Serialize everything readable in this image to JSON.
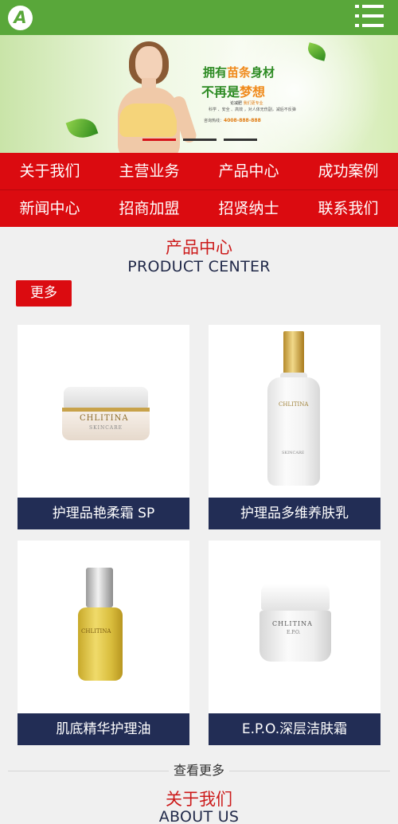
{
  "header": {
    "logo_letter": "A"
  },
  "icons": {
    "logo": "logo-icon",
    "menu": "hamburger-menu-icon"
  },
  "banner": {
    "headline_1_pre": "拥有",
    "headline_1_hl": "苗条",
    "headline_1_post": "身材",
    "headline_2_pre": "不再是",
    "headline_2_hl": "梦想",
    "brand_pre": "论减肥 ",
    "brand_hl": "我们更专业",
    "features": "科学 、安全 、高效 ，对人体无伤副，减后不反弹",
    "hotline_label": "咨询热线：",
    "hotline_number": "4008-888-888",
    "slides": [
      true,
      false,
      false
    ]
  },
  "nav": {
    "items": [
      "关于我们",
      "主营业务",
      "产品中心",
      "成功案例",
      "新闻中心",
      "招商加盟",
      "招贤纳士",
      "联系我们"
    ]
  },
  "products_section": {
    "title_cn": "产品中心",
    "title_en": "PRODUCT CENTER",
    "more_label": "更多",
    "view_more_label": "查看更多",
    "items": [
      {
        "name": "护理品艳柔霜 SP",
        "brand": "CHLITINA",
        "sub": "SKINCARE"
      },
      {
        "name": "护理品多维养肤乳",
        "brand": "CHLITINA",
        "sub": "SKINCARE"
      },
      {
        "name": "肌底精华护理油",
        "brand": "CHLITINA"
      },
      {
        "name": "E.P.O.深层洁肤霜",
        "brand": "CHLITINA",
        "sub": "E.P.O."
      }
    ]
  },
  "about_section": {
    "title_cn": "关于我们",
    "title_en": "ABOUT US"
  },
  "colors": {
    "header_green": "#59a73a",
    "nav_red": "#db0b10",
    "label_navy": "#222d55",
    "title_red": "#cc1a1a"
  }
}
